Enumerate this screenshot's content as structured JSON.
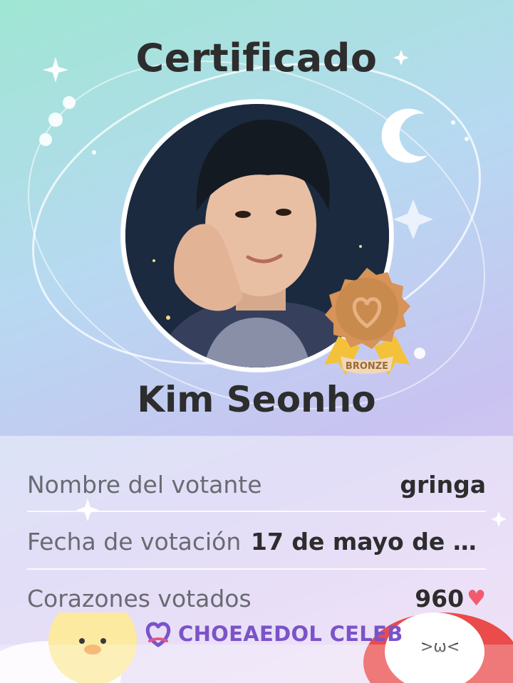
{
  "certificate": {
    "title": "Certificado",
    "celebrity_name": "Kim Seonho",
    "badge_label": "BRONZE",
    "rows": [
      {
        "label": "Nombre del votante",
        "value": "gringa"
      },
      {
        "label": "Fecha de votación",
        "value": "17 de mayo de 2..."
      },
      {
        "label": "Corazones votados",
        "value": "960"
      }
    ]
  },
  "brand": {
    "name": "CHOEAEDOL CELEB"
  },
  "colors": {
    "accent": "#7b53c9",
    "heart": "#f25a6e",
    "medal": "#c98a4e",
    "ribbon": "#f3c23a"
  },
  "icons": {
    "heart": "heart-icon",
    "logo": "choeaedol-heart-logo",
    "medal": "bronze-medal-icon"
  }
}
